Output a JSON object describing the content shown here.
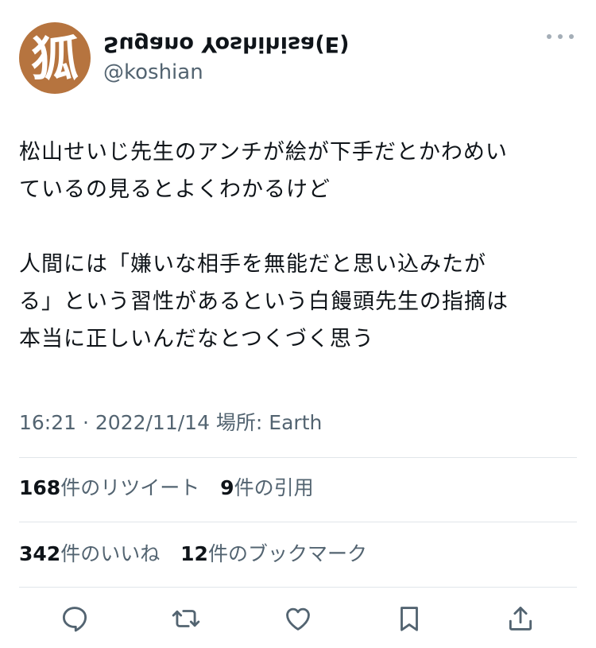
{
  "author": {
    "avatar_glyph": "狐",
    "avatar_color": "#b6743f",
    "display_name": "Sugano Yoshihisa(E)",
    "display_name_rendered_flipped": true,
    "username": "@koshian"
  },
  "tweet": {
    "lines": [
      "松山せいじ先生のアンチが絵が下手だとかわめい",
      "ているの見るとよくわかるけど",
      "",
      "人間には「嫌いな相手を無能だと思い込みたが",
      "る」という習性があるという白饅頭先生の指摘は",
      "本当に正しいんだなとつくづく思う"
    ],
    "timestamp": "16:21 · 2022/11/14 場所: Earth"
  },
  "stats": {
    "retweets_count": "168",
    "retweets_label": "件のリツイート",
    "quotes_count": "9",
    "quotes_label": "件の引用",
    "likes_count": "342",
    "likes_label": "件のいいね",
    "bookmarks_count": "12",
    "bookmarks_label": "件のブックマーク"
  },
  "actions": {
    "icons": [
      "reply-icon",
      "retweet-icon",
      "like-icon",
      "bookmark-icon",
      "share-icon"
    ],
    "icon_color": "#536471"
  },
  "colors": {
    "text_primary": "#0f1419",
    "text_secondary": "#536471",
    "divider": "#e1e6ea"
  }
}
